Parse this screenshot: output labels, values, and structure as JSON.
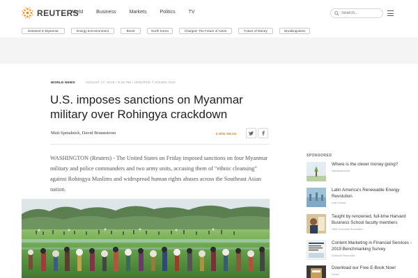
{
  "header": {
    "logo_text": "REUTERS",
    "nav": [
      "World",
      "Business",
      "Markets",
      "Politics",
      "TV"
    ],
    "search_placeholder": "Search..."
  },
  "topics": [
    "Detained In Myanmar",
    "Energy & Environment",
    "Brexit",
    "North Korea",
    "Charged: The Future of Autos",
    "Future of Money",
    "Breakingviews"
  ],
  "article": {
    "kicker": "WORLD NEWS",
    "dateline": "AUGUST 17, 2018 / 6:25 PM / UPDATED 7 HOURS AGO",
    "headline": "U.S. imposes sanctions on Myanmar military over Rohingya crackdown",
    "authors": "Matt Spetalnick, David Brunnstrom",
    "read_time": "6 MIN READ",
    "lead": "WASHINGTON (Reuters) - The United States on Friday imposed sanctions on four Myanmar military and police commanders and two army units, accusing them of “ethnic cleansing” against Rohingya Muslims and widespread human rights abuses across the Southeast Asian nation."
  },
  "sponsored": {
    "label": "SPONSORED",
    "items": [
      {
        "title": "Where is the clever money going?",
        "source": "Hardwickcloud"
      },
      {
        "title": "Latin America's Renewable Energy Revolution",
        "source": "Latin Invest"
      },
      {
        "title": "Taught by renowned, full-time Harvard Business School faculty members",
        "source": "HBS Executive Education"
      },
      {
        "title": "Content Marketing in Financial Services - 2019 Benchmarking Survey",
        "source": "Editorial Financials"
      },
      {
        "title": "Download our Free E-Book Now!",
        "source": "Orbex"
      }
    ]
  },
  "colors": {
    "brand_orange": "#f28a1e",
    "read_time": "#e07b2a",
    "text_dark": "#222222"
  },
  "icons": {
    "search": "search-icon",
    "menu": "hamburger-menu-icon",
    "twitter": "twitter-icon",
    "facebook": "facebook-icon"
  }
}
